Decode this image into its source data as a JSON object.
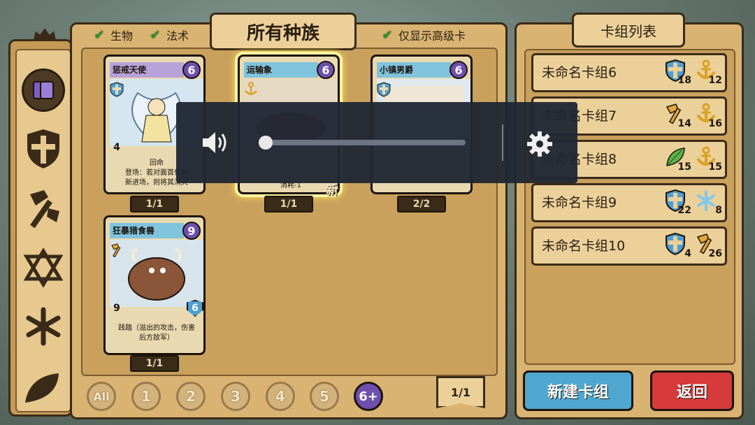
{
  "filters": {
    "creature_label": "生物",
    "spell_label": "法术",
    "advanced_only_label": "仅显示高级卡"
  },
  "race_title": "所有种族",
  "cards": [
    {
      "name": "惩戒天使",
      "cost": "6",
      "attack": "4",
      "ability": "回命",
      "text": "登场：若对面首位敌\n新进场，则将其消灭",
      "count": "1/1"
    },
    {
      "name": "运输象",
      "cost": "6",
      "text": "消耗-1",
      "count": "1/1",
      "new_label": "新"
    },
    {
      "name": "小镇男爵",
      "cost": "6",
      "count": "2/2"
    },
    {
      "name": "狂暴猎食兽",
      "cost": "9",
      "attack": "9",
      "health": "6",
      "text": "践踏（溢出的攻击，伤害\n后方敌军）",
      "count": "1/1"
    }
  ],
  "cost_filters": [
    "All",
    "1",
    "2",
    "3",
    "4",
    "5",
    "6+"
  ],
  "active_cost_filter": "6+",
  "page": "1/1",
  "deck_panel_title": "卡组列表",
  "decks": [
    {
      "name": "未命名卡组6",
      "badges": [
        {
          "icon": "shield-icon",
          "count": "18"
        },
        {
          "icon": "anchor-icon",
          "count": "12"
        }
      ]
    },
    {
      "name": "未命名卡组7",
      "badges": [
        {
          "icon": "axe-icon",
          "count": "14"
        },
        {
          "icon": "anchor-icon",
          "count": "16"
        }
      ]
    },
    {
      "name": "未命名卡组8",
      "badges": [
        {
          "icon": "leaf-icon",
          "count": "15"
        },
        {
          "icon": "anchor-icon",
          "count": "15"
        }
      ]
    },
    {
      "name": "未命名卡组9",
      "badges": [
        {
          "icon": "shield-icon",
          "count": "22"
        },
        {
          "icon": "snowflake-icon",
          "count": "8"
        }
      ]
    },
    {
      "name": "未命名卡组10",
      "badges": [
        {
          "icon": "shield-icon",
          "count": "4"
        },
        {
          "icon": "axe-icon",
          "count": "26"
        }
      ]
    }
  ],
  "new_deck_label": "新建卡组",
  "back_label": "返回",
  "volume": {
    "level": 0.0
  },
  "colors": {
    "accent_purple": "#6e4fae",
    "new_deck_button": "#4fa7cf",
    "back_button": "#d63a3a",
    "check_green": "#2f8e2a"
  }
}
